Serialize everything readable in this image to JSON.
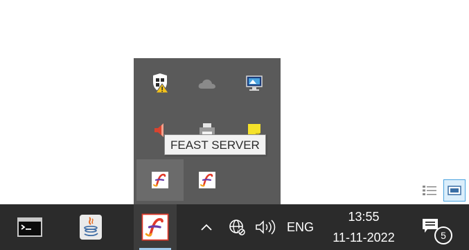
{
  "tooltip": {
    "text": "FEAST SERVER"
  },
  "tray_flyout": {
    "icons": [
      {
        "name": "windows-security-icon"
      },
      {
        "name": "onedrive-cloud-icon"
      },
      {
        "name": "remote-display-icon"
      },
      {
        "name": "speaker-muted-icon"
      },
      {
        "name": "printer-icon"
      },
      {
        "name": "sticky-note-icon"
      },
      {
        "name": "feast-server-icon"
      },
      {
        "name": "feast-client-icon"
      }
    ]
  },
  "taskbar": {
    "apps": [
      {
        "name": "command-prompt-icon"
      },
      {
        "name": "java-icon"
      },
      {
        "name": "feast-app-icon"
      }
    ],
    "system_tray": {
      "language": "ENG",
      "time": "13:55",
      "date": "11-11-2022",
      "notification_count": "5"
    }
  },
  "colors": {
    "taskbar_bg": "#2b2b2b",
    "flyout_bg": "#5a5a5a",
    "accent_underline": "#9fc7ea",
    "feast_red": "#e23a2a"
  }
}
